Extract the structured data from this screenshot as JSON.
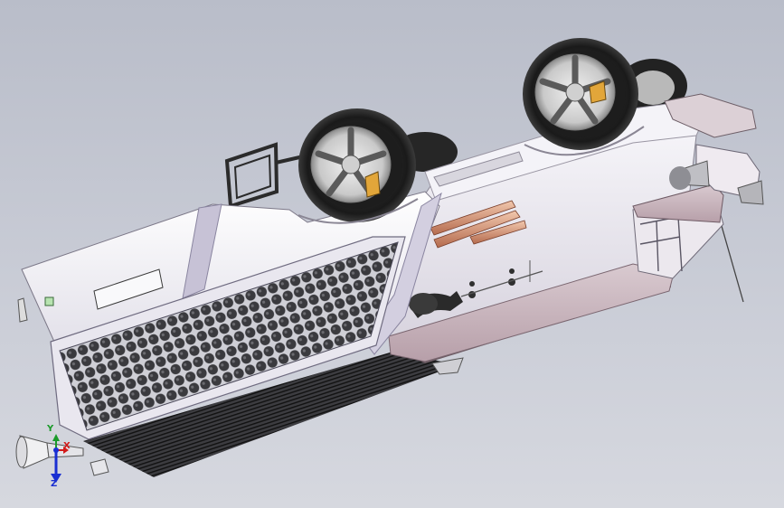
{
  "viewport": {
    "background_top": "#b9bdc9",
    "background_bottom": "#d6d8df"
  },
  "model": {
    "description_icon": "overturned-vehicle-cad-model"
  },
  "triad": {
    "x_label": "X",
    "y_label": "Y",
    "z_label": "Z",
    "x_color": "#d21a1a",
    "y_color": "#1a9a2a",
    "z_color": "#1a2fd2"
  }
}
